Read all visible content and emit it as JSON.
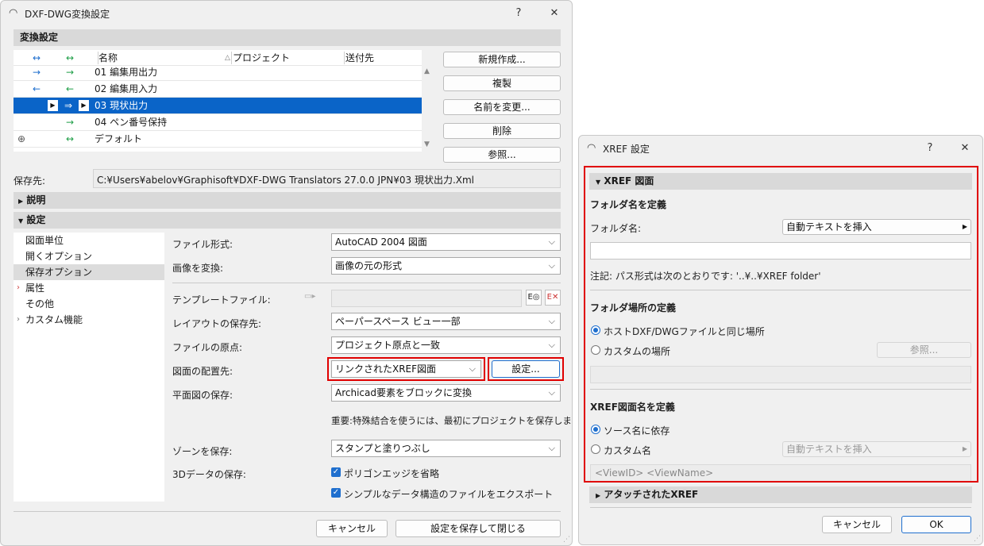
{
  "left_window": {
    "title": "DXF-DWG変換設定",
    "help": "?",
    "close": "✕",
    "section_translation": "変換設定",
    "list_headers": {
      "col_arrow1": "↔",
      "col_arrow2": "↔",
      "name": "名称",
      "project": "プロジェクト",
      "dest": "送付先"
    },
    "list_rows": [
      {
        "a1": "→",
        "a2": "→",
        "name": "01 編集用出力"
      },
      {
        "a1": "←",
        "a2": "←",
        "name": "02 編集用入力"
      },
      {
        "a1": "",
        "a2": "⇒",
        "name": "03 現状出力"
      },
      {
        "a1": "",
        "a2": "→",
        "name": "04 ペン番号保持"
      },
      {
        "a1": "",
        "a2": "↔",
        "name": "デフォルト"
      }
    ],
    "buttons": {
      "new": "新規作成...",
      "copy": "複製",
      "rename": "名前を変更...",
      "delete": "削除",
      "browse": "参照..."
    },
    "save_to_label": "保存先:",
    "save_to_path": "C:¥Users¥abelov¥Graphisoft¥DXF-DWG Translators 27.0.0 JPN¥03 現状出力.Xml",
    "section_description": "説明",
    "section_settings": "設定",
    "nav": [
      "図面単位",
      "開くオプション",
      "保存オプション",
      "属性",
      "その他",
      "カスタム機能"
    ],
    "fields": {
      "file_format_label": "ファイル形式:",
      "file_format_value": "AutoCAD 2004 図面",
      "convert_image_label": "画像を変換:",
      "convert_image_value": "画像の元の形式",
      "template_label": "テンプレートファイル:",
      "layout_label": "レイアウトの保存先:",
      "layout_value": "ペーパースペース ビュー一部",
      "origin_label": "ファイルの原点:",
      "origin_value": "プロジェクト原点と一致",
      "placement_label": "図面の配置先:",
      "placement_value": "リンクされたXREF図面",
      "placement_settings": "設定...",
      "plan_label": "平面図の保存:",
      "plan_value": "Archicad要素をブロックに変換",
      "important_note": "重要:特殊結合を使うには、最初にプロジェクトを保存します。",
      "zone_label": "ゾーンを保存:",
      "zone_value": "スタンプと塗りつぶし",
      "data3d_label": "3Dデータの保存:",
      "check_polygon": "ポリゴンエッジを省略",
      "check_simple": "シンプルなデータ構造のファイルをエクスポート"
    },
    "footer": {
      "cancel": "キャンセル",
      "save_close": "設定を保存して閉じる"
    }
  },
  "right_window": {
    "title": "XREF 設定",
    "help": "?",
    "close": "✕",
    "section_xref": "XREF 図面",
    "folder_name_hdr": "フォルダ名を定義",
    "folder_name_label": "フォルダ名:",
    "insert_autotext": "自動テキストを挿入",
    "note": "注記: パス形式は次のとおりです:   '..¥..¥XREF folder'",
    "folder_loc_hdr": "フォルダ場所の定義",
    "radio_same": "ホストDXF/DWGファイルと同じ場所",
    "radio_custom_loc": "カスタムの場所",
    "browse": "参照...",
    "xref_name_hdr": "XREF図面名を定義",
    "radio_source": "ソース名に依存",
    "radio_custom_name": "カスタム名",
    "insert_autotext2": "自動テキストを挿入",
    "name_template": "<ViewID> <ViewName>",
    "section_attached": "アタッチされたXREF",
    "cancel": "キャンセル",
    "ok": "OK"
  }
}
